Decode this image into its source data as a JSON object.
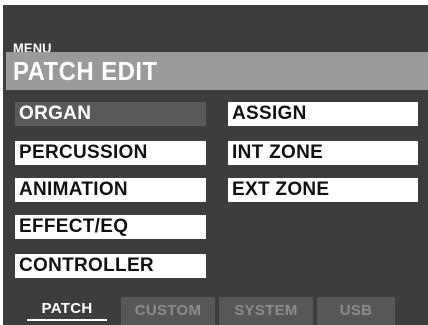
{
  "header": {
    "menu_label": "MENU",
    "title": "PATCH EDIT"
  },
  "menu": {
    "left_items": [
      {
        "label": "ORGAN",
        "selected": true
      },
      {
        "label": "PERCUSSION",
        "selected": false
      },
      {
        "label": "ANIMATION",
        "selected": false
      },
      {
        "label": "EFFECT/EQ",
        "selected": false
      },
      {
        "label": "CONTROLLER",
        "selected": false
      }
    ],
    "right_items": [
      {
        "label": "ASSIGN",
        "selected": false
      },
      {
        "label": "INT ZONE",
        "selected": false
      },
      {
        "label": "EXT ZONE",
        "selected": false
      }
    ]
  },
  "tabs": [
    {
      "label": "PATCH",
      "active": true
    },
    {
      "label": "CUSTOM",
      "active": false
    },
    {
      "label": "SYSTEM",
      "active": false
    },
    {
      "label": "USB",
      "active": false
    }
  ],
  "colors": {
    "screen_bg": "#3d3d3d",
    "title_bar": "#9a9a9a",
    "item_bg": "#ffffff",
    "item_selected_bg": "#5a5a5a",
    "tab_inactive_bg": "#575757"
  }
}
